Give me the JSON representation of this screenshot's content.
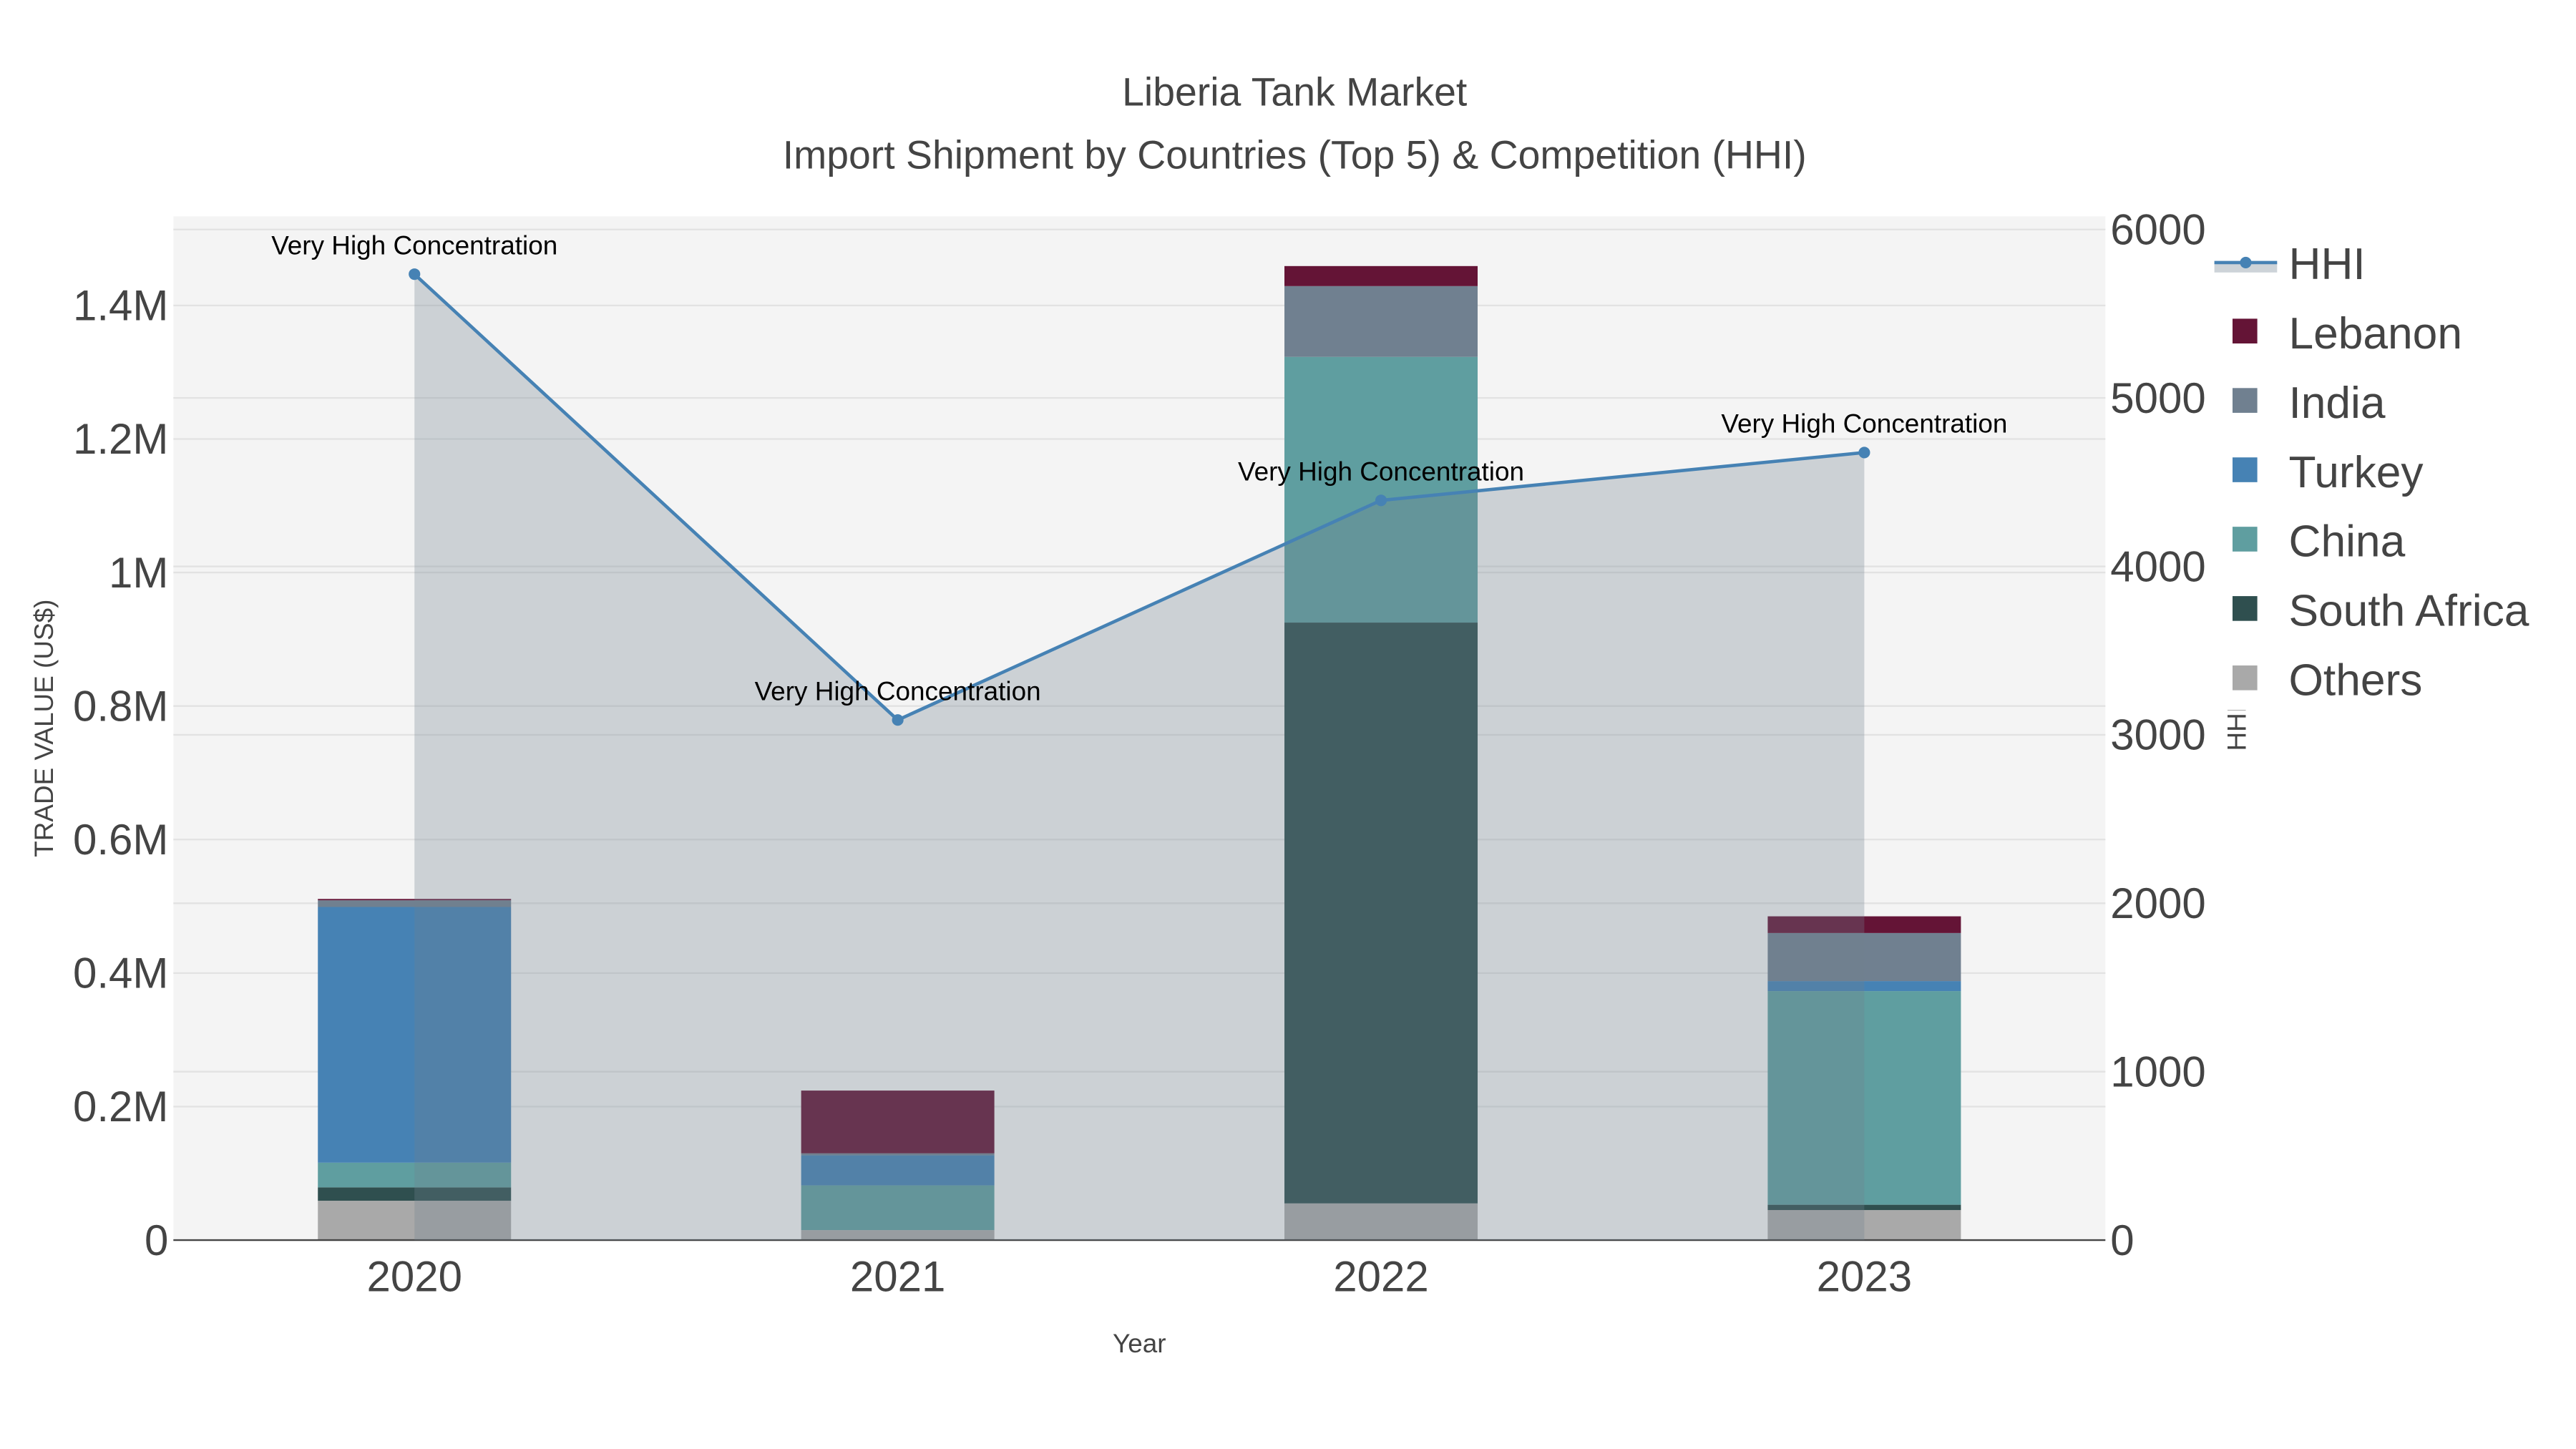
{
  "chart_data": {
    "type": "bar",
    "title": "Liberia Tank Market",
    "subtitle": "Import Shipment by Countries (Top 5) & Competition (HHI)",
    "xlabel": "Year",
    "ylabel": "TRADE VALUE (US$)",
    "y2label": "HHI",
    "categories": [
      "2020",
      "2021",
      "2022",
      "2023"
    ],
    "ylim": [
      0,
      1535000
    ],
    "y2lim": [
      0,
      6000
    ],
    "yticks": [
      {
        "v": 0,
        "label": "0"
      },
      {
        "v": 200000,
        "label": "0.2M"
      },
      {
        "v": 400000,
        "label": "0.4M"
      },
      {
        "v": 600000,
        "label": "0.6M"
      },
      {
        "v": 800000,
        "label": "0.8M"
      },
      {
        "v": 1000000,
        "label": "1M"
      },
      {
        "v": 1200000,
        "label": "1.2M"
      },
      {
        "v": 1400000,
        "label": "1.4M"
      }
    ],
    "y2ticks": [
      {
        "v": 0,
        "label": "0"
      },
      {
        "v": 1000,
        "label": "1000"
      },
      {
        "v": 2000,
        "label": "2000"
      },
      {
        "v": 3000,
        "label": "3000"
      },
      {
        "v": 4000,
        "label": "4000"
      },
      {
        "v": 5000,
        "label": "5000"
      },
      {
        "v": 6000,
        "label": "6000"
      }
    ],
    "series": [
      {
        "name": "Others",
        "color": "#a9a9a9",
        "values": [
          59000,
          15000,
          55000,
          45000
        ]
      },
      {
        "name": "South Africa",
        "color": "#2f4f4f",
        "values": [
          20000,
          0,
          870000,
          8000
        ]
      },
      {
        "name": "China",
        "color": "#5f9ea0",
        "values": [
          37000,
          67000,
          398000,
          320000
        ]
      },
      {
        "name": "Turkey",
        "color": "#4682b4",
        "values": [
          383000,
          45000,
          0,
          15000
        ]
      },
      {
        "name": "India",
        "color": "#708090",
        "values": [
          10000,
          3000,
          106000,
          72000
        ]
      },
      {
        "name": "Lebanon",
        "color": "#641436",
        "values": [
          2000,
          94000,
          30000,
          25000
        ]
      }
    ],
    "hhi": {
      "name": "HHI",
      "color": "#4682b4",
      "values": [
        5735,
        3088,
        4392,
        4676
      ],
      "annotations": [
        "Very High Concentration",
        "Very High Concentration",
        "Very High Concentration",
        "Very High Concentration"
      ]
    },
    "legend_order": [
      "HHI",
      "Lebanon",
      "India",
      "Turkey",
      "China",
      "South Africa",
      "Others"
    ],
    "legend_position": "right"
  }
}
